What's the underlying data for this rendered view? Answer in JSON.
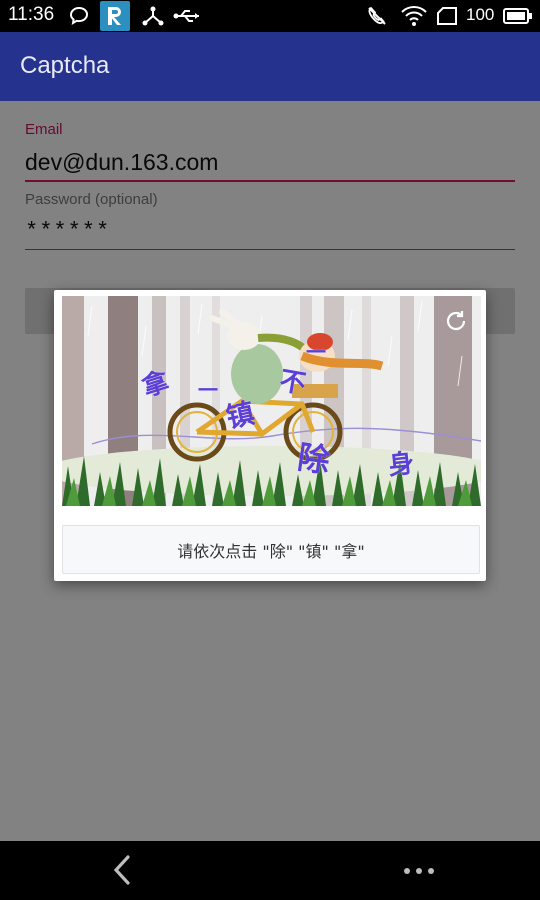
{
  "status_bar": {
    "time": "11:36",
    "battery_text": "100",
    "icons": [
      "chat-bubble-icon",
      "app-r-icon",
      "network-share-icon",
      "usb-icon",
      "no-call-icon",
      "wifi-icon",
      "sim-icon",
      "battery-icon"
    ]
  },
  "app_bar": {
    "title": "Captcha"
  },
  "form": {
    "email_label": "Email",
    "email_value": "dev@dun.163.com",
    "password_label": "Password (optional)",
    "password_value": "******"
  },
  "captcha": {
    "prompt": "请依次点击 \"除\" \"镇\" \"拿\"",
    "characters": [
      "拿",
      "一",
      "镇",
      "不",
      "一",
      "除",
      "身"
    ],
    "colors": {
      "accent": "#25338f",
      "email_accent": "#d81b60",
      "char": "#5b3fd6"
    }
  },
  "nav_bar": {
    "icons": [
      "back-icon",
      "more-icon"
    ]
  }
}
